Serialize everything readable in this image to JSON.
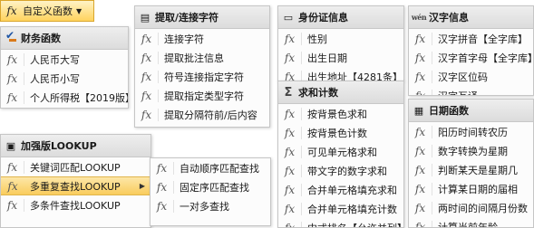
{
  "top_button": {
    "icon": "fx",
    "label": "自定义函数"
  },
  "menus": {
    "finance": {
      "header": "财务函数",
      "items": [
        "人民币大写",
        "人民币小写",
        "个人所得税【2019版】"
      ]
    },
    "text_join": {
      "header": "提取/连接字符",
      "items": [
        "连接字符",
        "提取批注信息",
        "符号连接指定字符",
        "提取指定类型字符",
        "提取分隔符前/后内容"
      ]
    },
    "idcard": {
      "header": "身份证信息",
      "items": [
        "性别",
        "出生日期",
        "出生地址【4281条】"
      ]
    },
    "chinese": {
      "header": "汉字信息",
      "items": [
        "汉字拼音【全字库】",
        "汉字首字母【全字库】",
        "汉字区位码",
        "汉字互译"
      ]
    },
    "sum_count": {
      "header": "求和计数",
      "items": [
        "按背景色求和",
        "按背景色计数",
        "可见单元格求和",
        "带文字的数字求和",
        "合并单元格填充求和",
        "合并单元格填充计数",
        "中式排名【允许并列】"
      ]
    },
    "date": {
      "header": "日期函数",
      "items": [
        "阳历时间转农历",
        "数字转换为星期",
        "判断某天是星期几",
        "计算某日期的届相",
        "两时间的间隔月份数",
        "计算当前年龄"
      ]
    },
    "lookup": {
      "header": "加强版LOOKUP",
      "items": [
        "关键词匹配LOOKUP",
        "多重复查找LOOKUP",
        "多条件查找LOOKUP"
      ]
    },
    "lookup_sub": {
      "items": [
        "自动顺序匹配查找",
        "固定序匹配查找",
        "一对多查找"
      ]
    }
  }
}
